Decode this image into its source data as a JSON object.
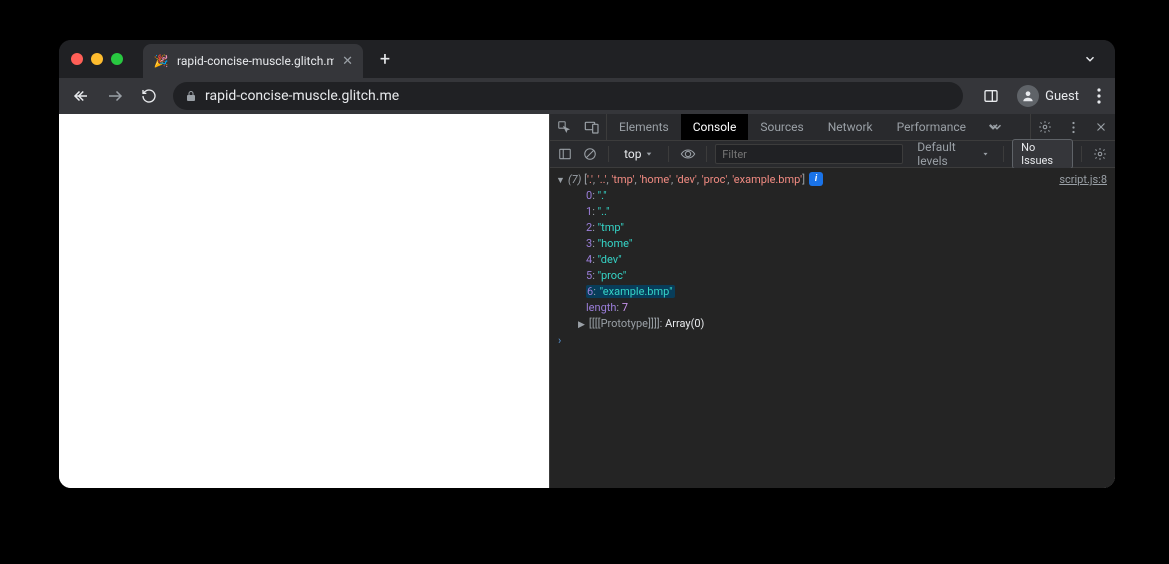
{
  "browser": {
    "tab_title": "rapid-concise-muscle.glitch.m",
    "url_display": "rapid-concise-muscle.glitch.me",
    "guest_label": "Guest"
  },
  "devtools": {
    "tabs": {
      "elements": "Elements",
      "console": "Console",
      "sources": "Sources",
      "network": "Network",
      "performance": "Performance"
    },
    "toolbar": {
      "context": "top",
      "filter_placeholder": "Filter",
      "levels": "Default levels",
      "issues": "No Issues"
    },
    "console": {
      "summary_count": "(7)",
      "summary_items": [
        "'.'",
        "'..'",
        "'tmp'",
        "'home'",
        "'dev'",
        "'proc'",
        "'example.bmp'"
      ],
      "source_link": "script.js:8",
      "entries": [
        {
          "index": "0",
          "value": "\".\""
        },
        {
          "index": "1",
          "value": "\"..\""
        },
        {
          "index": "2",
          "value": "\"tmp\""
        },
        {
          "index": "3",
          "value": "\"home\""
        },
        {
          "index": "4",
          "value": "\"dev\""
        },
        {
          "index": "5",
          "value": "\"proc\""
        },
        {
          "index": "6",
          "value": "\"example.bmp\"",
          "highlighted": true
        }
      ],
      "length_label": "length",
      "length_value": "7",
      "prototype_label": "[[Prototype]]",
      "prototype_value": "Array(0)"
    }
  }
}
